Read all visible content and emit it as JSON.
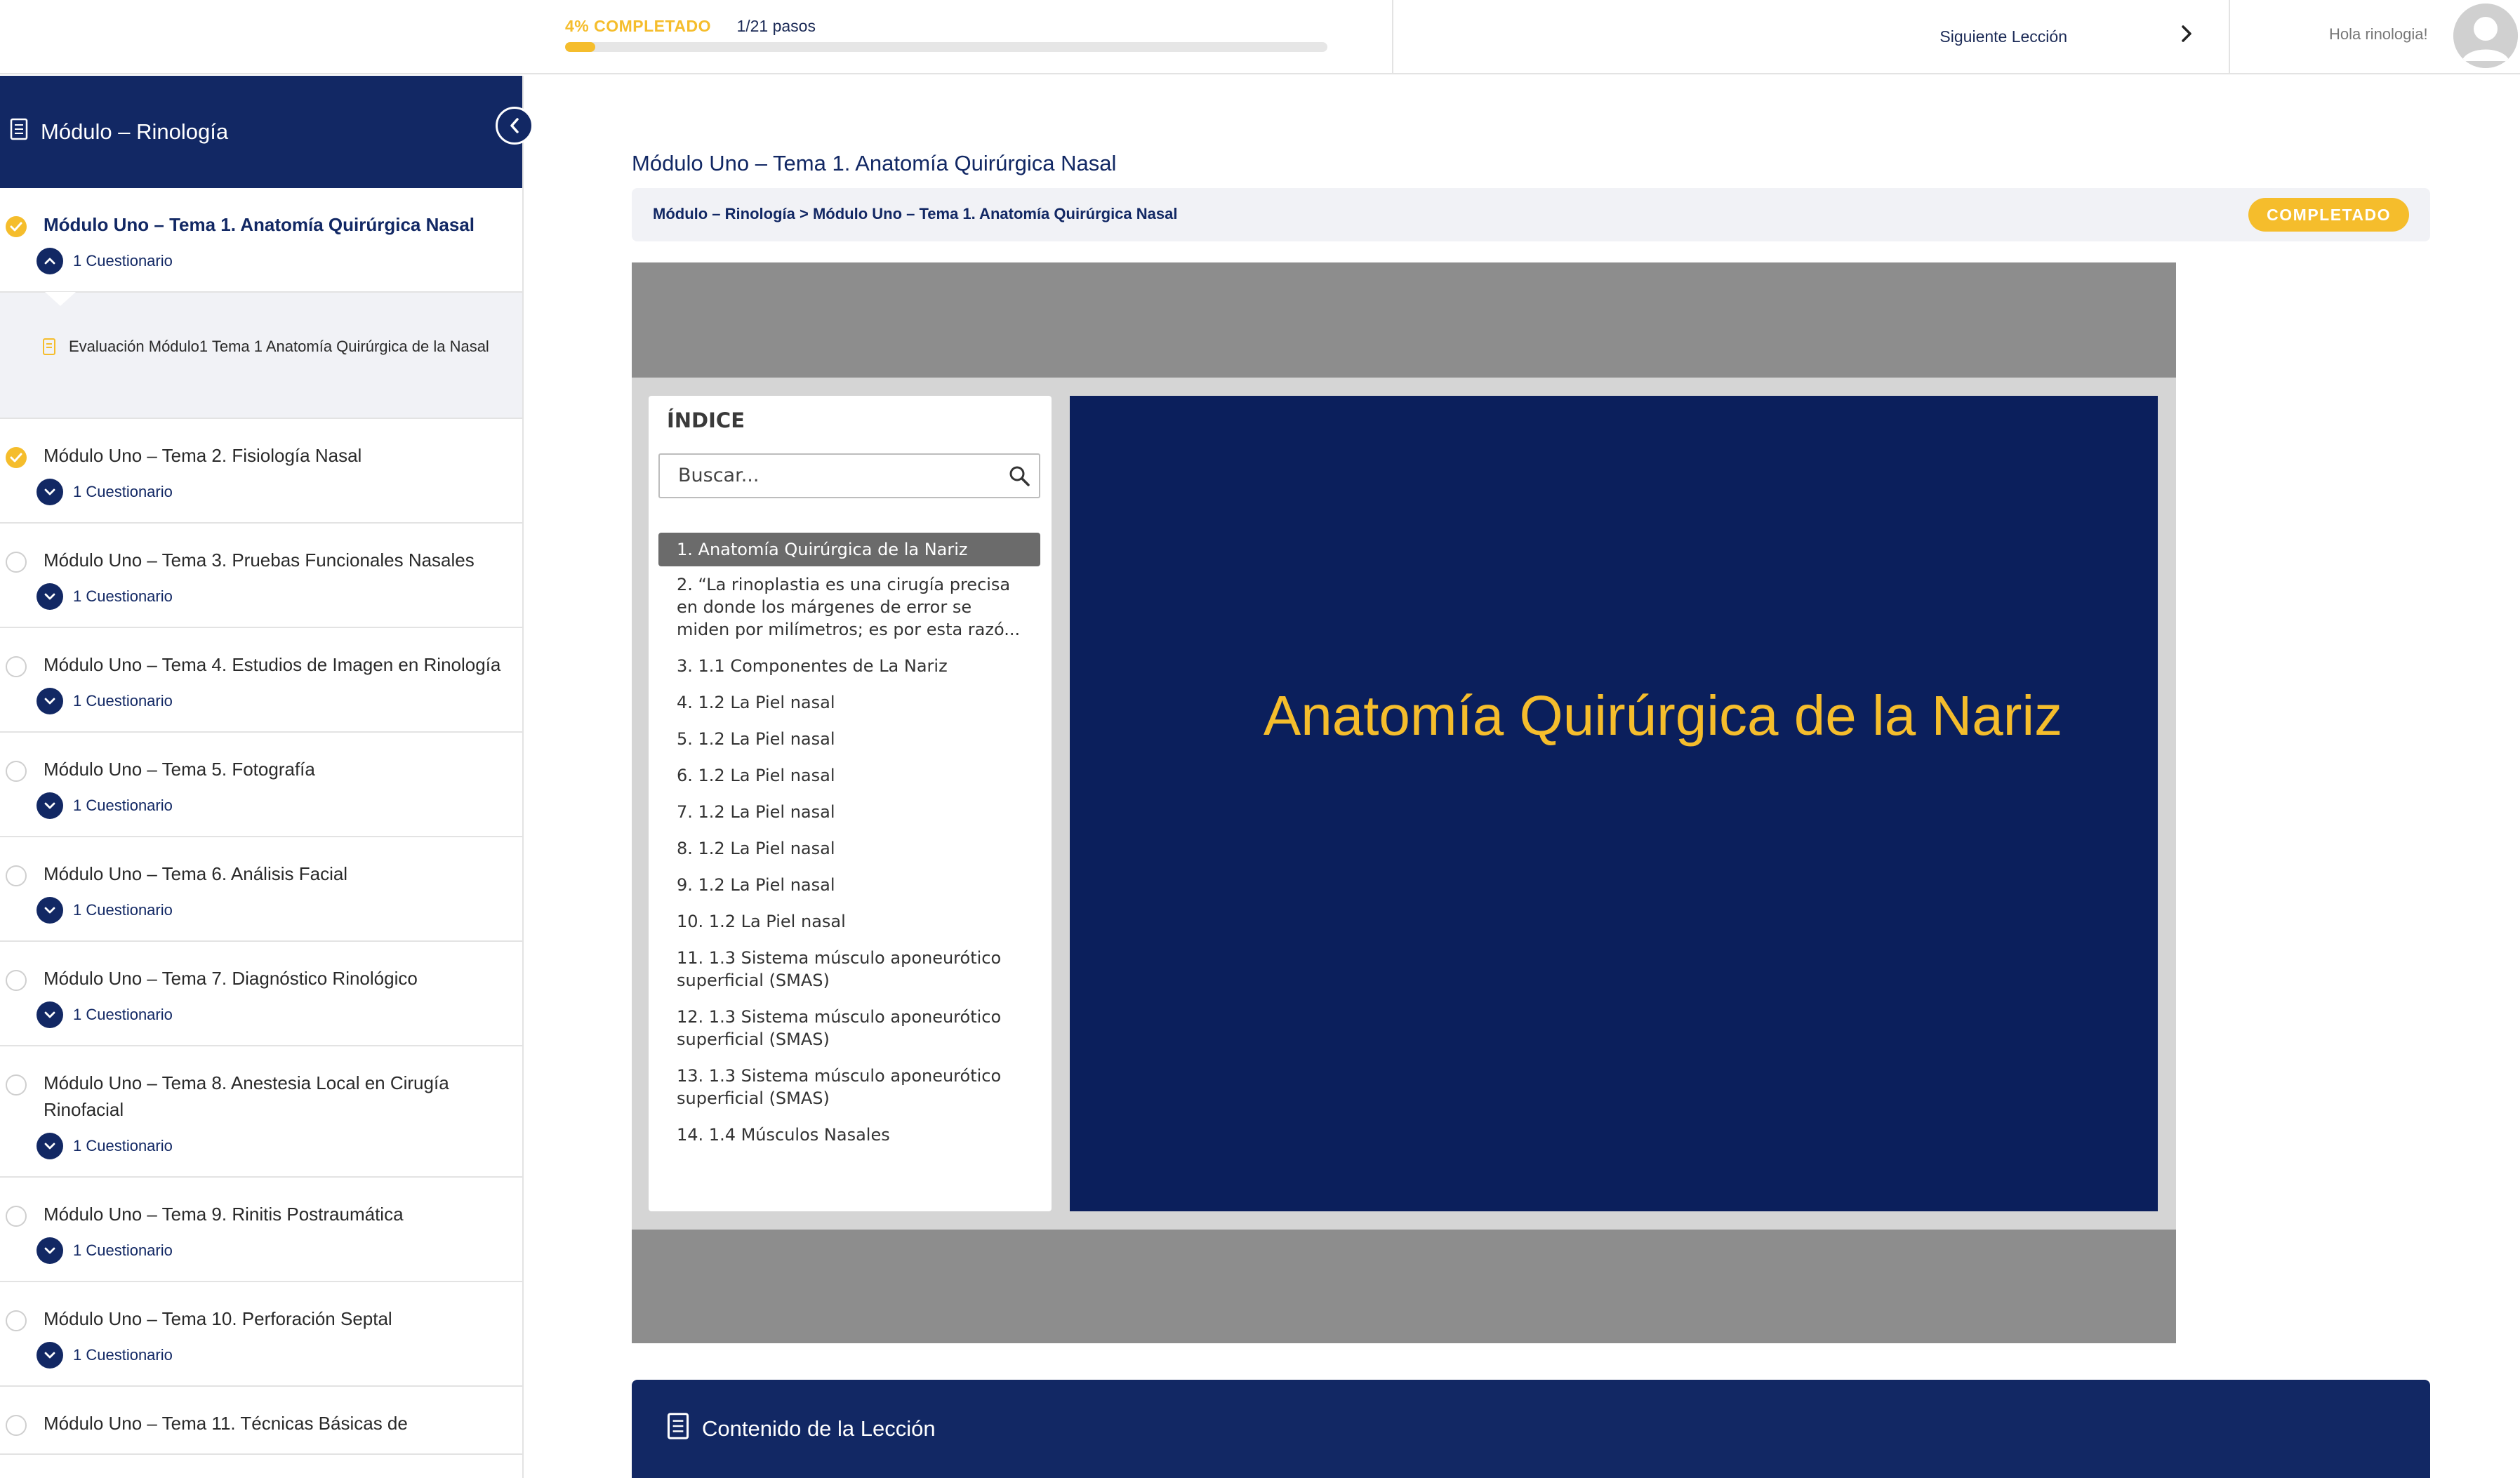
{
  "progress": {
    "percent_label": "4% COMPLETADO",
    "steps_label": "1/21 pasos",
    "fraction": 0.04
  },
  "header": {
    "next_lesson_label": "Siguiente Lección",
    "greeting": "Hola rinologia!"
  },
  "sidebar": {
    "course_title": "Módulo – Rinología",
    "lessons": [
      {
        "title": "Módulo Uno – Tema 1. Anatomía Quirúrgica Nasal",
        "quiz": "1 Cuestionario",
        "status": "done",
        "active": true
      },
      {
        "title": "Módulo Uno – Tema 2. Fisiología Nasal",
        "quiz": "1 Cuestionario",
        "status": "done"
      },
      {
        "title": "Módulo Uno – Tema 3. Pruebas Funcionales Nasales",
        "quiz": "1 Cuestionario",
        "status": "todo"
      },
      {
        "title": "Módulo Uno – Tema 4. Estudios de Imagen en Rinología",
        "quiz": "1 Cuestionario",
        "status": "todo"
      },
      {
        "title": "Módulo Uno – Tema 5. Fotografía",
        "quiz": "1 Cuestionario",
        "status": "todo"
      },
      {
        "title": "Módulo Uno – Tema 6. Análisis Facial",
        "quiz": "1 Cuestionario",
        "status": "todo"
      },
      {
        "title": "Módulo Uno – Tema 7. Diagnóstico Rinológico",
        "quiz": "1 Cuestionario",
        "status": "todo"
      },
      {
        "title": "Módulo Uno – Tema 8. Anestesia Local en Cirugía Rinofacial",
        "quiz": "1 Cuestionario",
        "status": "todo"
      },
      {
        "title": "Módulo Uno – Tema 9. Rinitis Postraumática",
        "quiz": "1 Cuestionario",
        "status": "todo"
      },
      {
        "title": "Módulo Uno – Tema 10. Perforación Septal",
        "quiz": "1 Cuestionario",
        "status": "todo"
      },
      {
        "title": "Módulo Uno – Tema 11. Técnicas Básicas de",
        "quiz": "",
        "status": "todo"
      }
    ],
    "expanded_quiz_item": "Evaluación Módulo1 Tema 1 Anatomía Quirúrgica de la Nasal"
  },
  "main": {
    "lesson_heading": "Módulo Uno – Tema 1. Anatomía Quirúrgica Nasal",
    "breadcrumb": "Módulo – Rinología > Módulo Uno – Tema 1. Anatomía Quirúrgica Nasal",
    "completed_badge": "COMPLETADO",
    "content_bar_label": "Contenido de la Lección"
  },
  "player": {
    "toc_title": "ÍNDICE",
    "search_placeholder": "Buscar...",
    "toc_items": [
      "1. Anatomía Quirúrgica de la Nariz",
      "2. “La rinoplastia es una cirugía precisa en donde los márgenes de error se miden por milímetros; es por esta razó...",
      "3. 1.1 Componentes de La Nariz",
      "4. 1.2 La Piel nasal",
      "5. 1.2 La Piel nasal",
      "6. 1.2 La Piel nasal",
      "7. 1.2 La Piel nasal",
      "8. 1.2 La Piel nasal",
      "9. 1.2 La Piel nasal",
      "10. 1.2 La Piel nasal",
      "11. 1.3 Sistema músculo aponeurótico superficial (SMAS)",
      "12. 1.3 Sistema músculo aponeurótico superficial (SMAS)",
      "13. 1.3 Sistema músculo aponeurótico superficial (SMAS)",
      "14. 1.4 Músculos Nasales"
    ],
    "slide_title": "Anatomía Quirúrgica de la Nariz"
  },
  "colors": {
    "navy": "#122864",
    "slide_bg": "#0b1f5c",
    "accent_yellow": "#f5bd2c"
  }
}
